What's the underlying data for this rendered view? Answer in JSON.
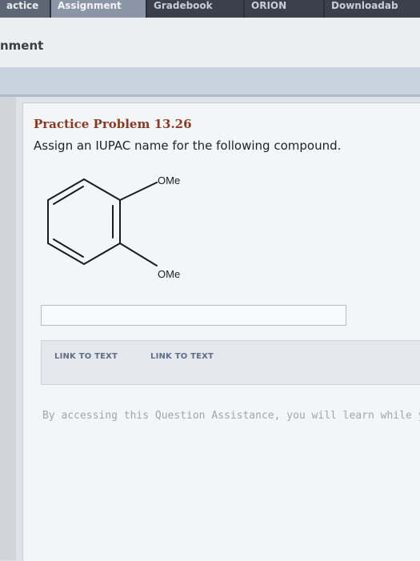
{
  "nav": {
    "tabs": [
      {
        "label": "actice"
      },
      {
        "label": "Assignment"
      },
      {
        "label": "Gradebook"
      },
      {
        "label": "ORION"
      },
      {
        "label": "Downloadab"
      }
    ]
  },
  "header": {
    "title": "nment"
  },
  "problem": {
    "title": "Practice Problem 13.26",
    "prompt": "Assign an IUPAC name for the following compound.",
    "molecule": {
      "substituent_top": "OMe",
      "substituent_bottom": "OMe"
    },
    "answer_value": ""
  },
  "links": {
    "link1": "LINK TO TEXT",
    "link2": "LINK TO TEXT"
  },
  "assistance_note": "By accessing this Question Assistance, you will learn while y"
}
